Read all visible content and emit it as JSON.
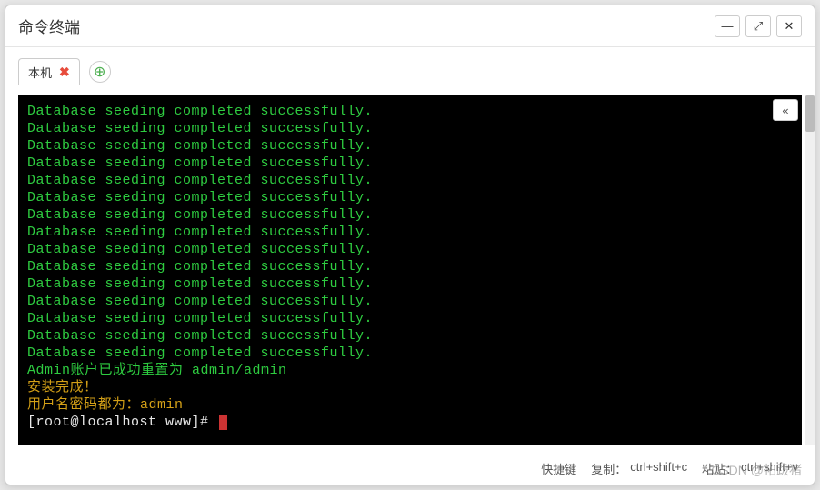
{
  "window": {
    "title": "命令终端",
    "controls": {
      "minimize": "—",
      "maximize": "⤢",
      "close": "✕"
    }
  },
  "tabs": {
    "active": {
      "label": "本机",
      "close_glyph": "✖"
    },
    "add_glyph": "⊕"
  },
  "terminal": {
    "lines_green": [
      "Database seeding completed successfully.",
      "Database seeding completed successfully.",
      "Database seeding completed successfully.",
      "Database seeding completed successfully.",
      "Database seeding completed successfully.",
      "Database seeding completed successfully.",
      "Database seeding completed successfully.",
      "Database seeding completed successfully.",
      "Database seeding completed successfully.",
      "Database seeding completed successfully.",
      "Database seeding completed successfully.",
      "Database seeding completed successfully.",
      "Database seeding completed successfully.",
      "Database seeding completed successfully.",
      "Database seeding completed successfully."
    ],
    "admin_reset": "Admin账户已成功重置为 admin/admin",
    "install_done": "安装完成！",
    "creds": "用户名密码都为：admin",
    "prompt": "[root@localhost www]# "
  },
  "collapse_glyph": "«",
  "statusbar": {
    "shortcut_label": "快捷键",
    "copy_label": "复制：",
    "copy_key": "ctrl+shift+c",
    "paste_label": "粘贴：",
    "paste_key": "ctrl+shift+v"
  },
  "watermark": "CSDN @拓跋猪"
}
